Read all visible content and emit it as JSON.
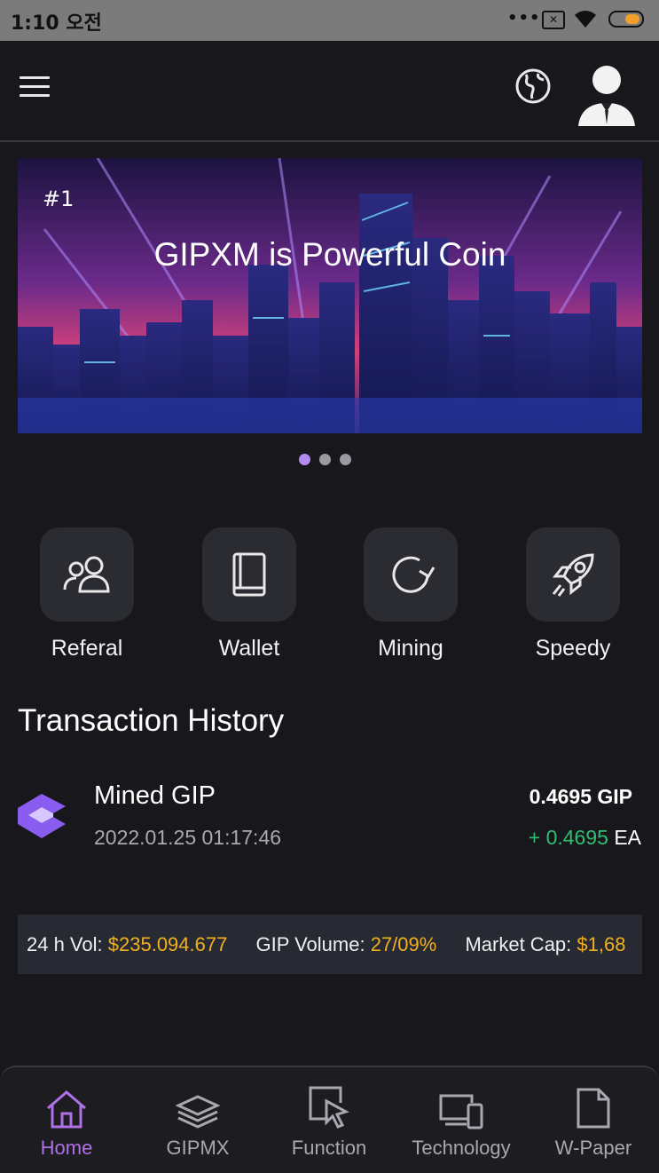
{
  "status_bar": {
    "time": "1:10 오전",
    "more": "•••",
    "sim": "✕"
  },
  "banner": {
    "number": "#1",
    "title": "GIPXM is Powerful Coin",
    "slides": 3,
    "active_slide": 1
  },
  "quick_actions": [
    {
      "label": "Referal",
      "icon": "users-icon"
    },
    {
      "label": "Wallet",
      "icon": "book-icon"
    },
    {
      "label": "Mining",
      "icon": "refresh-icon"
    },
    {
      "label": "Speedy",
      "icon": "rocket-icon"
    }
  ],
  "transactions": {
    "title": "Transaction History",
    "items": [
      {
        "name": "Mined GIP",
        "date": "2022.01.25 01:17:46",
        "amount": "0.4695 GIP",
        "change": "+ 0.4695",
        "unit": "EA"
      }
    ]
  },
  "ticker": [
    {
      "key": "24 h Vol:",
      "value": "$235.094.677"
    },
    {
      "key": "GIP Volume:",
      "value": "27/09%"
    },
    {
      "key": "Market Cap:",
      "value": "$1,68"
    }
  ],
  "nav": {
    "items": [
      {
        "label": "Home",
        "icon": "home-icon"
      },
      {
        "label": "GIPMX",
        "icon": "layers-icon"
      },
      {
        "label": "Function",
        "icon": "cursor-window-icon"
      },
      {
        "label": "Technology",
        "icon": "devices-icon"
      },
      {
        "label": "W-Paper",
        "icon": "document-icon"
      }
    ],
    "active": "Home"
  },
  "colors": {
    "background": "#18181c",
    "accent_purple": "#b070e8",
    "positive_green": "#2fbf71",
    "ticker_value": "#f2b01e",
    "tile": "#2b2c32"
  }
}
